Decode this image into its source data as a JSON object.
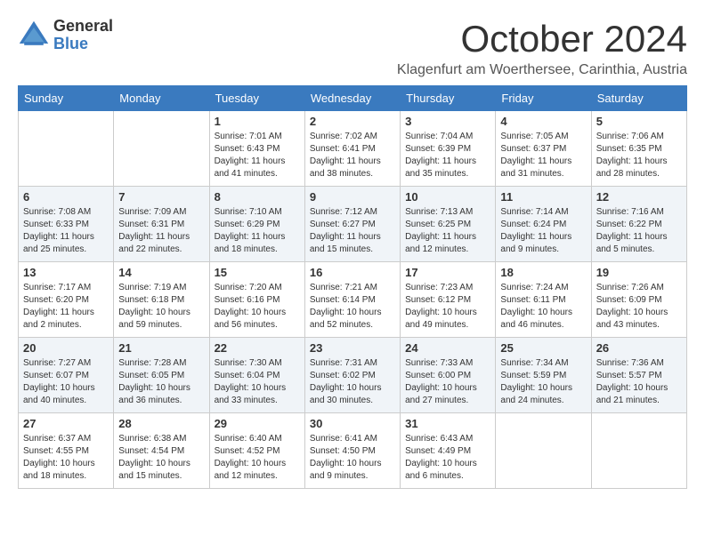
{
  "logo": {
    "general": "General",
    "blue": "Blue"
  },
  "title": "October 2024",
  "location": "Klagenfurt am Woerthersee, Carinthia, Austria",
  "headers": [
    "Sunday",
    "Monday",
    "Tuesday",
    "Wednesday",
    "Thursday",
    "Friday",
    "Saturday"
  ],
  "weeks": [
    [
      {
        "day": "",
        "info": ""
      },
      {
        "day": "",
        "info": ""
      },
      {
        "day": "1",
        "info": "Sunrise: 7:01 AM\nSunset: 6:43 PM\nDaylight: 11 hours and 41 minutes."
      },
      {
        "day": "2",
        "info": "Sunrise: 7:02 AM\nSunset: 6:41 PM\nDaylight: 11 hours and 38 minutes."
      },
      {
        "day": "3",
        "info": "Sunrise: 7:04 AM\nSunset: 6:39 PM\nDaylight: 11 hours and 35 minutes."
      },
      {
        "day": "4",
        "info": "Sunrise: 7:05 AM\nSunset: 6:37 PM\nDaylight: 11 hours and 31 minutes."
      },
      {
        "day": "5",
        "info": "Sunrise: 7:06 AM\nSunset: 6:35 PM\nDaylight: 11 hours and 28 minutes."
      }
    ],
    [
      {
        "day": "6",
        "info": "Sunrise: 7:08 AM\nSunset: 6:33 PM\nDaylight: 11 hours and 25 minutes."
      },
      {
        "day": "7",
        "info": "Sunrise: 7:09 AM\nSunset: 6:31 PM\nDaylight: 11 hours and 22 minutes."
      },
      {
        "day": "8",
        "info": "Sunrise: 7:10 AM\nSunset: 6:29 PM\nDaylight: 11 hours and 18 minutes."
      },
      {
        "day": "9",
        "info": "Sunrise: 7:12 AM\nSunset: 6:27 PM\nDaylight: 11 hours and 15 minutes."
      },
      {
        "day": "10",
        "info": "Sunrise: 7:13 AM\nSunset: 6:25 PM\nDaylight: 11 hours and 12 minutes."
      },
      {
        "day": "11",
        "info": "Sunrise: 7:14 AM\nSunset: 6:24 PM\nDaylight: 11 hours and 9 minutes."
      },
      {
        "day": "12",
        "info": "Sunrise: 7:16 AM\nSunset: 6:22 PM\nDaylight: 11 hours and 5 minutes."
      }
    ],
    [
      {
        "day": "13",
        "info": "Sunrise: 7:17 AM\nSunset: 6:20 PM\nDaylight: 11 hours and 2 minutes."
      },
      {
        "day": "14",
        "info": "Sunrise: 7:19 AM\nSunset: 6:18 PM\nDaylight: 10 hours and 59 minutes."
      },
      {
        "day": "15",
        "info": "Sunrise: 7:20 AM\nSunset: 6:16 PM\nDaylight: 10 hours and 56 minutes."
      },
      {
        "day": "16",
        "info": "Sunrise: 7:21 AM\nSunset: 6:14 PM\nDaylight: 10 hours and 52 minutes."
      },
      {
        "day": "17",
        "info": "Sunrise: 7:23 AM\nSunset: 6:12 PM\nDaylight: 10 hours and 49 minutes."
      },
      {
        "day": "18",
        "info": "Sunrise: 7:24 AM\nSunset: 6:11 PM\nDaylight: 10 hours and 46 minutes."
      },
      {
        "day": "19",
        "info": "Sunrise: 7:26 AM\nSunset: 6:09 PM\nDaylight: 10 hours and 43 minutes."
      }
    ],
    [
      {
        "day": "20",
        "info": "Sunrise: 7:27 AM\nSunset: 6:07 PM\nDaylight: 10 hours and 40 minutes."
      },
      {
        "day": "21",
        "info": "Sunrise: 7:28 AM\nSunset: 6:05 PM\nDaylight: 10 hours and 36 minutes."
      },
      {
        "day": "22",
        "info": "Sunrise: 7:30 AM\nSunset: 6:04 PM\nDaylight: 10 hours and 33 minutes."
      },
      {
        "day": "23",
        "info": "Sunrise: 7:31 AM\nSunset: 6:02 PM\nDaylight: 10 hours and 30 minutes."
      },
      {
        "day": "24",
        "info": "Sunrise: 7:33 AM\nSunset: 6:00 PM\nDaylight: 10 hours and 27 minutes."
      },
      {
        "day": "25",
        "info": "Sunrise: 7:34 AM\nSunset: 5:59 PM\nDaylight: 10 hours and 24 minutes."
      },
      {
        "day": "26",
        "info": "Sunrise: 7:36 AM\nSunset: 5:57 PM\nDaylight: 10 hours and 21 minutes."
      }
    ],
    [
      {
        "day": "27",
        "info": "Sunrise: 6:37 AM\nSunset: 4:55 PM\nDaylight: 10 hours and 18 minutes."
      },
      {
        "day": "28",
        "info": "Sunrise: 6:38 AM\nSunset: 4:54 PM\nDaylight: 10 hours and 15 minutes."
      },
      {
        "day": "29",
        "info": "Sunrise: 6:40 AM\nSunset: 4:52 PM\nDaylight: 10 hours and 12 minutes."
      },
      {
        "day": "30",
        "info": "Sunrise: 6:41 AM\nSunset: 4:50 PM\nDaylight: 10 hours and 9 minutes."
      },
      {
        "day": "31",
        "info": "Sunrise: 6:43 AM\nSunset: 4:49 PM\nDaylight: 10 hours and 6 minutes."
      },
      {
        "day": "",
        "info": ""
      },
      {
        "day": "",
        "info": ""
      }
    ]
  ]
}
